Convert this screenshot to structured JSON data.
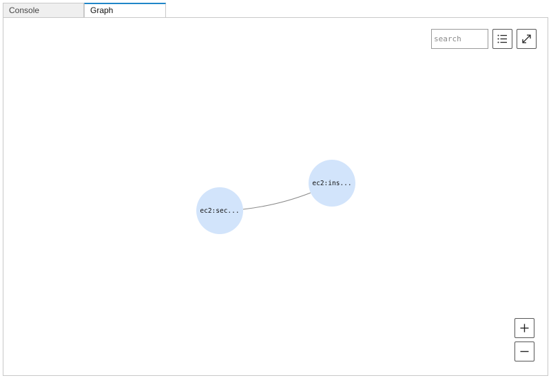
{
  "tabs": [
    {
      "label": "Console",
      "active": false
    },
    {
      "label": "Graph",
      "active": true
    }
  ],
  "graph_toolbar": {
    "search_placeholder": "search",
    "list_icon": "list-icon",
    "expand_icon": "expand-icon"
  },
  "zoom_controls": {
    "zoom_in_icon": "plus-icon",
    "zoom_out_icon": "minus-icon"
  },
  "graph": {
    "nodes": [
      {
        "id": "n1",
        "label": "ec2:sec..."
      },
      {
        "id": "n2",
        "label": "ec2:ins..."
      }
    ],
    "edges": [
      {
        "source": "n1",
        "target": "n2"
      }
    ],
    "node_color": "#d2e4fb",
    "edge_color": "#888888",
    "active_tab_accent": "#1f86c8"
  }
}
